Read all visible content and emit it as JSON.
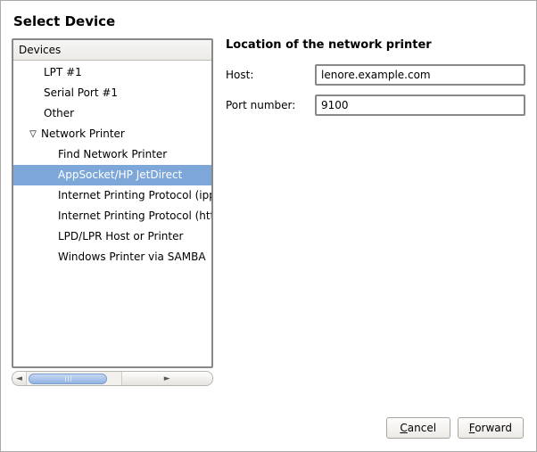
{
  "title": "Select Device",
  "devices_header": "Devices",
  "tree": {
    "lpt1": "LPT #1",
    "serial1": "Serial Port #1",
    "other": "Other",
    "network_printer": "Network Printer",
    "find": "Find Network Printer",
    "appsocket": "AppSocket/HP JetDirect",
    "ipp": "Internet Printing Protocol (ipp)",
    "http": "Internet Printing Protocol (https)",
    "lpd": "LPD/LPR Host or Printer",
    "samba": "Windows Printer via SAMBA"
  },
  "expand_glyph": "▽",
  "section_label": "Location of the network printer",
  "host_label": "Host:",
  "port_label": "Port number:",
  "host_value": "lenore.example.com",
  "port_value": "9100",
  "buttons": {
    "cancel_pre": "",
    "cancel_mn": "C",
    "cancel_post": "ancel",
    "forward_pre": "",
    "forward_mn": "F",
    "forward_post": "orward"
  }
}
